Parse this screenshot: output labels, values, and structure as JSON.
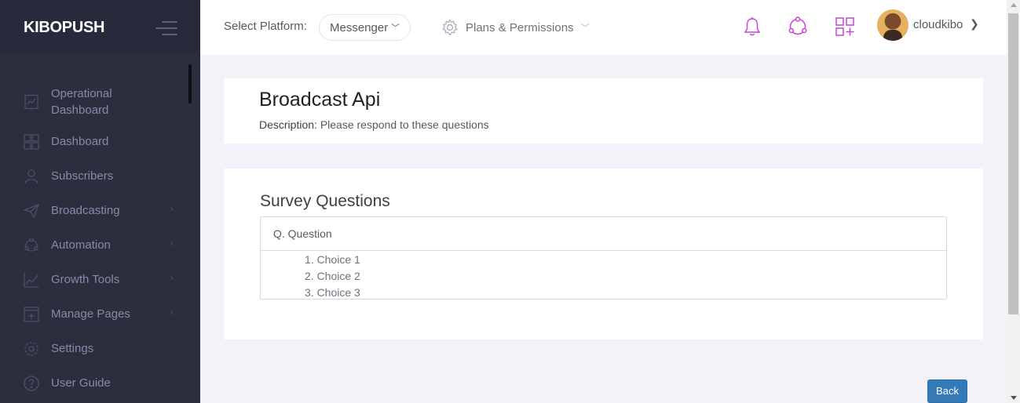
{
  "brand": {
    "name": "KIBOPUSH"
  },
  "sidebar": {
    "items": [
      {
        "label_line1": "Operational",
        "label_line2": "Dashboard",
        "icon": "chart-panel-icon",
        "has_arrow": false
      },
      {
        "label": "Dashboard",
        "icon": "grid-icon",
        "has_arrow": false
      },
      {
        "label": "Subscribers",
        "icon": "user-icon",
        "has_arrow": false
      },
      {
        "label": "Broadcasting",
        "icon": "paper-plane-icon",
        "has_arrow": true
      },
      {
        "label": "Automation",
        "icon": "share-circle-icon",
        "has_arrow": true
      },
      {
        "label": "Growth Tools",
        "icon": "line-chart-icon",
        "has_arrow": true
      },
      {
        "label": "Manage Pages",
        "icon": "add-page-icon",
        "has_arrow": true
      },
      {
        "label": "Settings",
        "icon": "gear-icon",
        "has_arrow": false
      },
      {
        "label": "User Guide",
        "icon": "question-circle-icon",
        "has_arrow": false
      }
    ],
    "arrow_glyph": "›"
  },
  "header": {
    "platform_label": "Select Platform:",
    "platform_value": "Messenger",
    "plans_label": "Plans & Permissions",
    "username": "cloudkibo",
    "accent_color": "#c643d6"
  },
  "broadcast": {
    "title": "Broadcast Api",
    "description_label": "Description:",
    "description_text": "Please respond to these questions"
  },
  "survey": {
    "title": "Survey Questions",
    "question": "Q. Question",
    "choices": [
      "1. Choice 1",
      "2. Choice 2",
      "3. Choice 3"
    ]
  },
  "actions": {
    "back_label": "Back"
  }
}
